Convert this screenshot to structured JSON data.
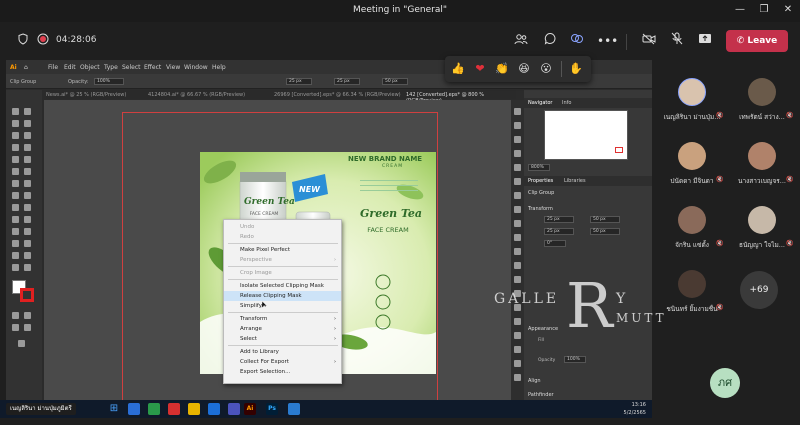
{
  "window": {
    "title": "Meeting in \"General\""
  },
  "meeting": {
    "timer": "04:28:06",
    "leave_label": "Leave"
  },
  "reactions": [
    "like",
    "heart",
    "applause",
    "laugh",
    "surprised",
    "raise-hand"
  ],
  "illustrator": {
    "menu": [
      "File",
      "Edit",
      "Object",
      "Type",
      "Select",
      "Effect",
      "View",
      "Window",
      "Help"
    ],
    "control_bar": {
      "selection": "Clip Group",
      "opacity_label": "Opacity:",
      "opacity_value": "100%",
      "x_value": "25 px",
      "y_value": "25 px",
      "w_value": "50 px"
    },
    "tabs": [
      "News.ai* @ 25 % (RGB/Preview)",
      "4124804.ai* @ 66.67 % (RGB/Preview)",
      "26969 [Converted].eps* @ 66.34 % (RGB/Preview)",
      "142 [Converted].eps* @ 800 % (RGB/Preview)"
    ],
    "artwork": {
      "headline": "NEW BRAND NAME",
      "subhead": "CREAM",
      "product": "Green Tea",
      "product_sub": "FACE CREAM",
      "badge": "NEW",
      "tube_label": "Green Tea",
      "tube_sub": "FACE CREAM",
      "tube_spf": "SPF 50 | PA+++"
    },
    "context_menu": {
      "items": [
        {
          "label": "Undo",
          "disabled": true
        },
        {
          "label": "Redo",
          "disabled": true
        },
        {
          "label": "Make Pixel Perfect",
          "disabled": false
        },
        {
          "label": "Perspective",
          "disabled": true,
          "submenu": true
        },
        {
          "label": "Crop Image",
          "disabled": true
        },
        {
          "label": "Isolate Selected Clipping Mask",
          "disabled": false
        },
        {
          "label": "Release Clipping Mask",
          "disabled": false,
          "highlighted": true
        },
        {
          "label": "Simplify...",
          "disabled": false
        },
        {
          "label": "Transform",
          "disabled": false,
          "submenu": true
        },
        {
          "label": "Arrange",
          "disabled": false,
          "submenu": true
        },
        {
          "label": "Select",
          "disabled": false,
          "submenu": true
        },
        {
          "label": "Add to Library",
          "disabled": false
        },
        {
          "label": "Collect For Export",
          "disabled": false,
          "submenu": true
        },
        {
          "label": "Export Selection...",
          "disabled": false
        }
      ]
    },
    "navigator": {
      "tab": "Navigator",
      "tab2": "Info",
      "zoom": "800%"
    },
    "properties": {
      "tab": "Properties",
      "tab2": "Libraries",
      "selection": "Clip Group",
      "transform_label": "Transform",
      "x": "25 px",
      "y": "25 px",
      "w": "50 px",
      "h": "50 px",
      "angle": "0°",
      "appearance_label": "Appearance",
      "fill_label": "Fill",
      "opacity_label": "Opacity",
      "opacity": "100%",
      "align_label": "Align",
      "pathfinder_label": "Pathfinder"
    },
    "status": {
      "zoom": "800%",
      "tool": "Selection"
    }
  },
  "taskbar": {
    "presenter_label": "เนญลิรินา ม่านปุ่มภูมิตรี",
    "time": "13:16",
    "date": "5/2/2565"
  },
  "participants": [
    {
      "name": "เนญลิรินา ม่านปุ่ม...",
      "muted": true
    },
    {
      "name": "เทพรัตน์ สว่าง...",
      "muted": true
    },
    {
      "name": "ปนัดดา มีจินดา",
      "muted": true
    },
    {
      "name": "นางสาวเบญจร...",
      "muted": true
    },
    {
      "name": "จักริน แซ่ตั้ง",
      "muted": true
    },
    {
      "name": "ธนัญญา ใจไม...",
      "muted": true
    },
    {
      "name": "ชนินทร์ ยิ้มงามชื่น",
      "muted": true
    }
  ],
  "more_participants": "+69",
  "self_initials": "ภศ",
  "watermark": {
    "text_left": "GALLE",
    "letter": "R",
    "text_right": "Y",
    "sub": "MUTT"
  }
}
